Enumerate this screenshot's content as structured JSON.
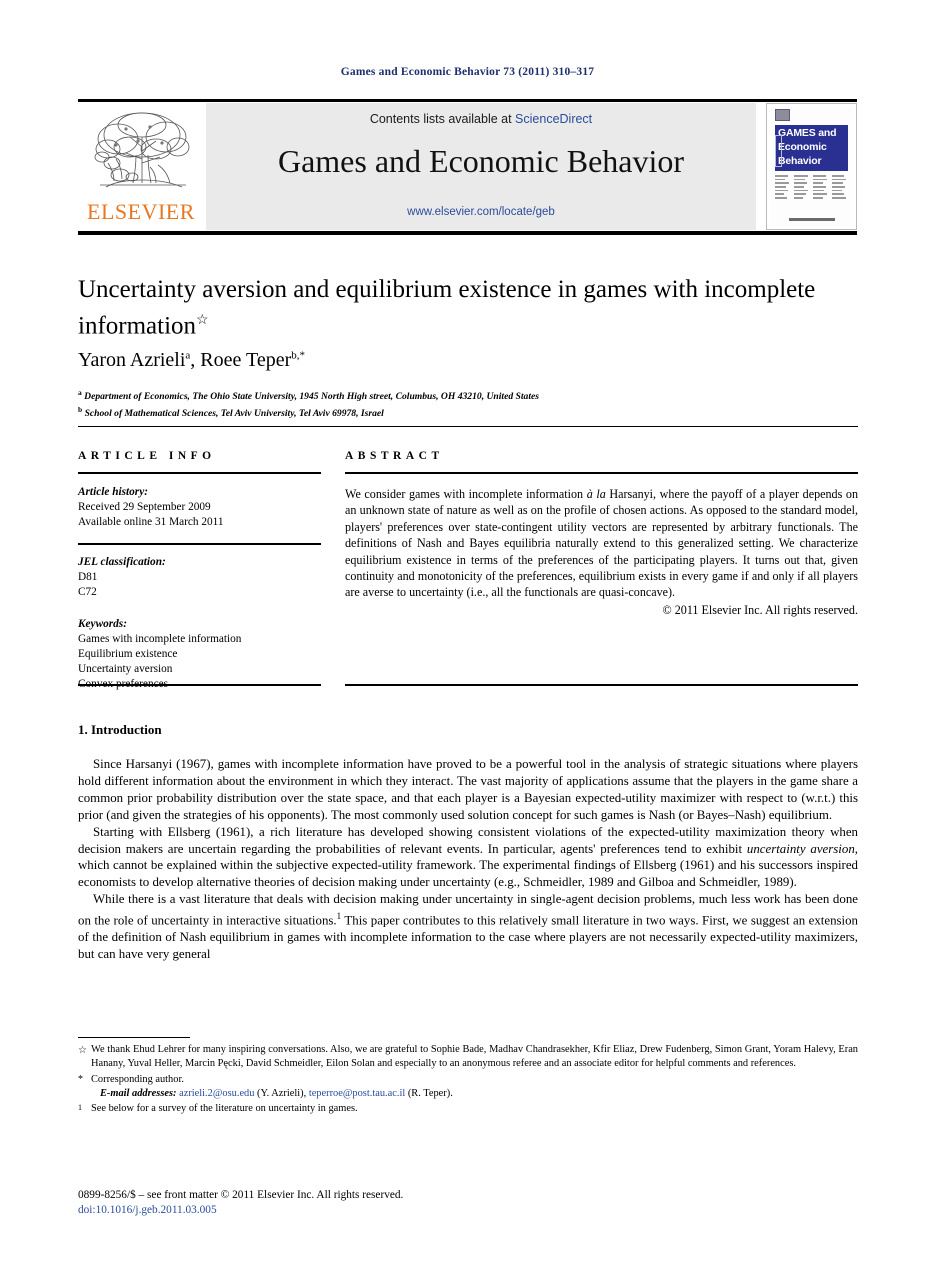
{
  "running_head": "Games and Economic Behavior 73 (2011) 310–317",
  "masthead": {
    "contents_prefix": "Contents lists available at ",
    "sciencedirect": "ScienceDirect",
    "journal_title": "Games and Economic Behavior",
    "journal_url": "www.elsevier.com/locate/geb",
    "publisher_logo_text": "ELSEVIER",
    "cover": {
      "line1": "GAMES and",
      "line2": "Economic",
      "line3": "Behavior"
    }
  },
  "article": {
    "title": "Uncertainty aversion and equilibrium existence in games with incomplete information",
    "title_footnote_marker": "☆",
    "authors": "Yaron Azrieli",
    "author1_sup": "a",
    "author2": ", Roee Teper",
    "author2_sup": "b,*",
    "affiliation_a_marker": "a",
    "affiliation_a": "Department of Economics, The Ohio State University, 1945 North High street, Columbus, OH 43210, United States",
    "affiliation_b_marker": "b",
    "affiliation_b": "School of Mathematical Sciences, Tel Aviv University, Tel Aviv 69978, Israel"
  },
  "info": {
    "heading": "ARTICLE INFO",
    "history_label": "Article history:",
    "received": "Received 29 September 2009",
    "available": "Available online 31 March 2011",
    "jel_label": "JEL classification:",
    "jel_codes": [
      "D81",
      "C72"
    ],
    "keywords_label": "Keywords:",
    "keywords": [
      "Games with incomplete information",
      "Equilibrium existence",
      "Uncertainty aversion",
      "Convex preferences"
    ]
  },
  "abstract": {
    "heading": "ABSTRACT",
    "part1": "We consider games with incomplete information ",
    "italic1": "à la",
    "part2": " Harsanyi, where the payoff of a player depends on an unknown state of nature as well as on the profile of chosen actions. As opposed to the standard model, players' preferences over state-contingent utility vectors are represented by arbitrary functionals. The definitions of Nash and Bayes equilibria naturally extend to this generalized setting. We characterize equilibrium existence in terms of the preferences of the participating players. It turns out that, given continuity and monotonicity of the preferences, equilibrium exists in every game if and only if all players are averse to uncertainty (i.e., all the functionals are quasi-concave).",
    "copyright": "© 2011 Elsevier Inc. All rights reserved."
  },
  "body": {
    "section_title": "1. Introduction",
    "para1": "Since Harsanyi (1967), games with incomplete information have proved to be a powerful tool in the analysis of strategic situations where players hold different information about the environment in which they interact. The vast majority of applications assume that the players in the game share a common prior probability distribution over the state space, and that each player is a Bayesian expected-utility maximizer with respect to (w.r.t.) this prior (and given the strategies of his opponents). The most commonly used solution concept for such games is Nash (or Bayes–Nash) equilibrium.",
    "para2_a": "Starting with Ellsberg (1961), a rich literature has developed showing consistent violations of the expected-utility maximization theory when decision makers are uncertain regarding the probabilities of relevant events. In particular, agents' preferences tend to exhibit ",
    "para2_italic": "uncertainty aversion",
    "para2_b": ", which cannot be explained within the subjective expected-utility framework. The experimental findings of Ellsberg (1961) and his successors inspired economists to develop alternative theories of decision making under uncertainty (e.g., Schmeidler, 1989 and Gilboa and Schmeidler, 1989).",
    "para3_a": "While there is a vast literature that deals with decision making under uncertainty in single-agent decision problems, much less work has been done on the role of uncertainty in interactive situations.",
    "para3_sup": "1",
    "para3_b": " This paper contributes to this relatively small literature in two ways. First, we suggest an extension of the definition of Nash equilibrium in games with incomplete information to the case where players are not necessarily expected-utility maximizers, but can have very general"
  },
  "footnotes": {
    "star_marker": "☆",
    "star_text": "We thank Ehud Lehrer for many inspiring conversations. Also, we are grateful to Sophie Bade, Madhav Chandrasekher, Kfir Eliaz, Drew Fudenberg, Simon Grant, Yoram Halevy, Eran Hanany, Yuval Heller, Marcin Pęcki, David Schmeidler, Eilon Solan and especially to an anonymous referee and an associate editor for helpful comments and references.",
    "corresponding_marker": "*",
    "corresponding_text": "Corresponding author.",
    "email_label": "E-mail addresses:",
    "email1": "azrieli.2@osu.edu",
    "email1_owner": " (Y. Azrieli),",
    "email2": "teperroe@post.tau.ac.il",
    "email2_owner": " (R. Teper).",
    "fn1_marker": "1",
    "fn1_text": "See below for a survey of the literature on uncertainty in games."
  },
  "imprint": {
    "issn_line": "0899-8256/$ – see front matter © 2011 Elsevier Inc. All rights reserved.",
    "doi": "doi:10.1016/j.geb.2011.03.005"
  },
  "colors": {
    "running_head": "#1c2f6e",
    "link_blue": "#2b4c9b",
    "elsevier_orange": "#E87722",
    "cover_blue": "#2a2f92",
    "band_grey": "#eaeaea"
  }
}
